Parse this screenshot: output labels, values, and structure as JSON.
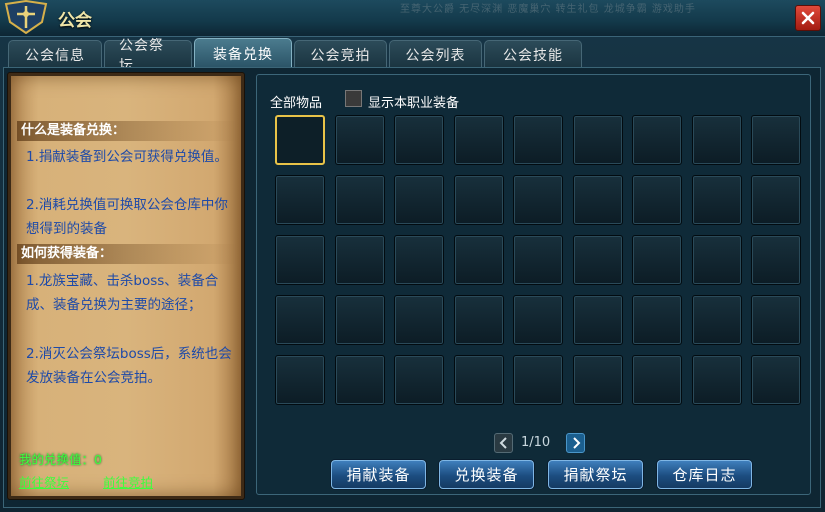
{
  "window": {
    "title": "公会"
  },
  "background": {
    "top_text": "至尊大公爵 无尽深渊 恶魔巢穴 转生礼包 龙城争霸 游戏助手"
  },
  "tabs": [
    {
      "label": "公会信息",
      "active": false
    },
    {
      "label": "公会祭坛",
      "active": false
    },
    {
      "label": "装备兑换",
      "active": true
    },
    {
      "label": "公会竞拍",
      "active": false
    },
    {
      "label": "公会列表",
      "active": false
    },
    {
      "label": "公会技能",
      "active": false
    }
  ],
  "info": {
    "section1_title": "什么是装备兑换：",
    "section1_item1": "1.捐献装备到公会可获得兑换值。",
    "section1_item2": "2.消耗兑换值可换取公会仓库中你想得到的装备",
    "section2_title": "如何获得装备：",
    "section2_item1": "1.龙族宝藏、击杀boss、装备合成、装备兑换为主要的途径；",
    "section2_item2": "2.消灭公会祭坛boss后，系统也会发放装备在公会竞拍。"
  },
  "exchange_value": {
    "text": "我的兑换值：0"
  },
  "links": {
    "altar": "前往祭坛",
    "auction": "前往竞拍"
  },
  "filter": {
    "all_items": "全部物品",
    "show_class_equipment": "显示本职业装备",
    "show_class_checked": false
  },
  "grid": {
    "rows": 5,
    "cols": 9,
    "selected_index": 0
  },
  "pagination": {
    "text": "1/10"
  },
  "actions": {
    "donate_equipment": "捐献装备",
    "exchange_equipment": "兑换装备",
    "donate_altar": "捐献祭坛",
    "warehouse_log": "仓库日志"
  },
  "colors": {
    "accent_gold": "#e8c348",
    "link_green": "#3cff3c",
    "info_blue": "#1e4aa8",
    "close_red": "#c12a1c"
  }
}
